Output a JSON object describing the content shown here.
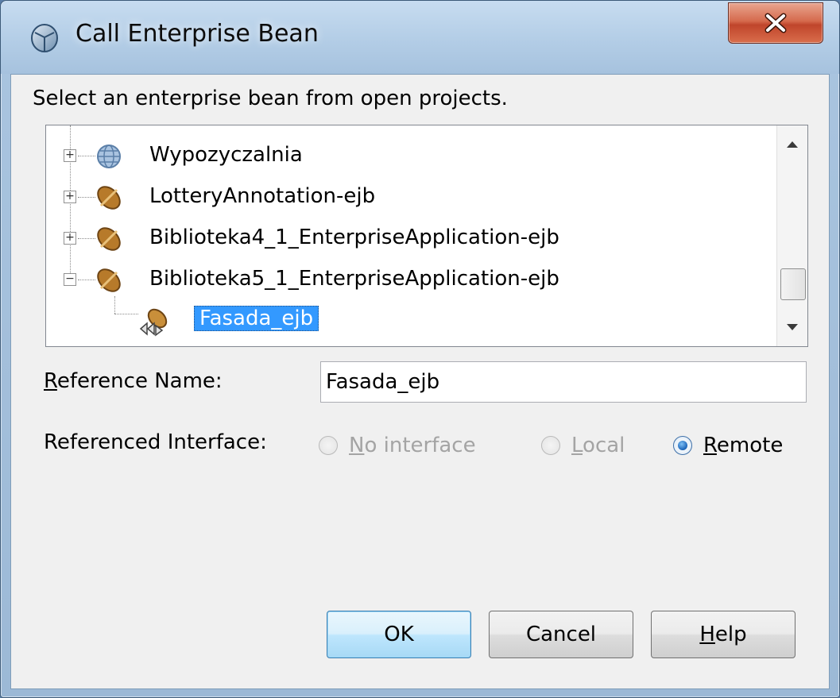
{
  "window": {
    "title": "Call Enterprise Bean",
    "close_glyph": "X"
  },
  "instruction": "Select an enterprise bean from open projects.",
  "tree": {
    "nodes": [
      {
        "label": "Wypozyczalnia",
        "expander": "+",
        "icon": "web-globe-icon"
      },
      {
        "label": "LotteryAnnotation-ejb",
        "expander": "+",
        "icon": "bean-icon"
      },
      {
        "label": "Biblioteka4_1_EnterpriseApplication-ejb",
        "expander": "+",
        "icon": "bean-icon"
      },
      {
        "label": "Biblioteka5_1_EnterpriseApplication-ejb",
        "expander": "−",
        "icon": "bean-icon"
      }
    ],
    "selected_child": {
      "label": "Fasada_ejb",
      "icon": "session-bean-icon"
    }
  },
  "reference_name": {
    "label_underlined": "R",
    "label_rest": "eference Name:",
    "value": "Fasada_ejb"
  },
  "referenced_interface": {
    "label": "Referenced Interface:",
    "options": [
      {
        "underlined": "N",
        "rest": "o interface",
        "enabled": false,
        "checked": false
      },
      {
        "underlined": "L",
        "rest": "ocal",
        "enabled": false,
        "checked": false
      },
      {
        "underlined": "R",
        "rest": "emote",
        "enabled": true,
        "checked": true
      }
    ]
  },
  "buttons": {
    "ok": "OK",
    "cancel": "Cancel",
    "help_underlined": "H",
    "help_rest": "elp"
  },
  "colors": {
    "selection": "#3399ff",
    "close_button": "#c0452b",
    "default_button": "#bee6fd"
  }
}
